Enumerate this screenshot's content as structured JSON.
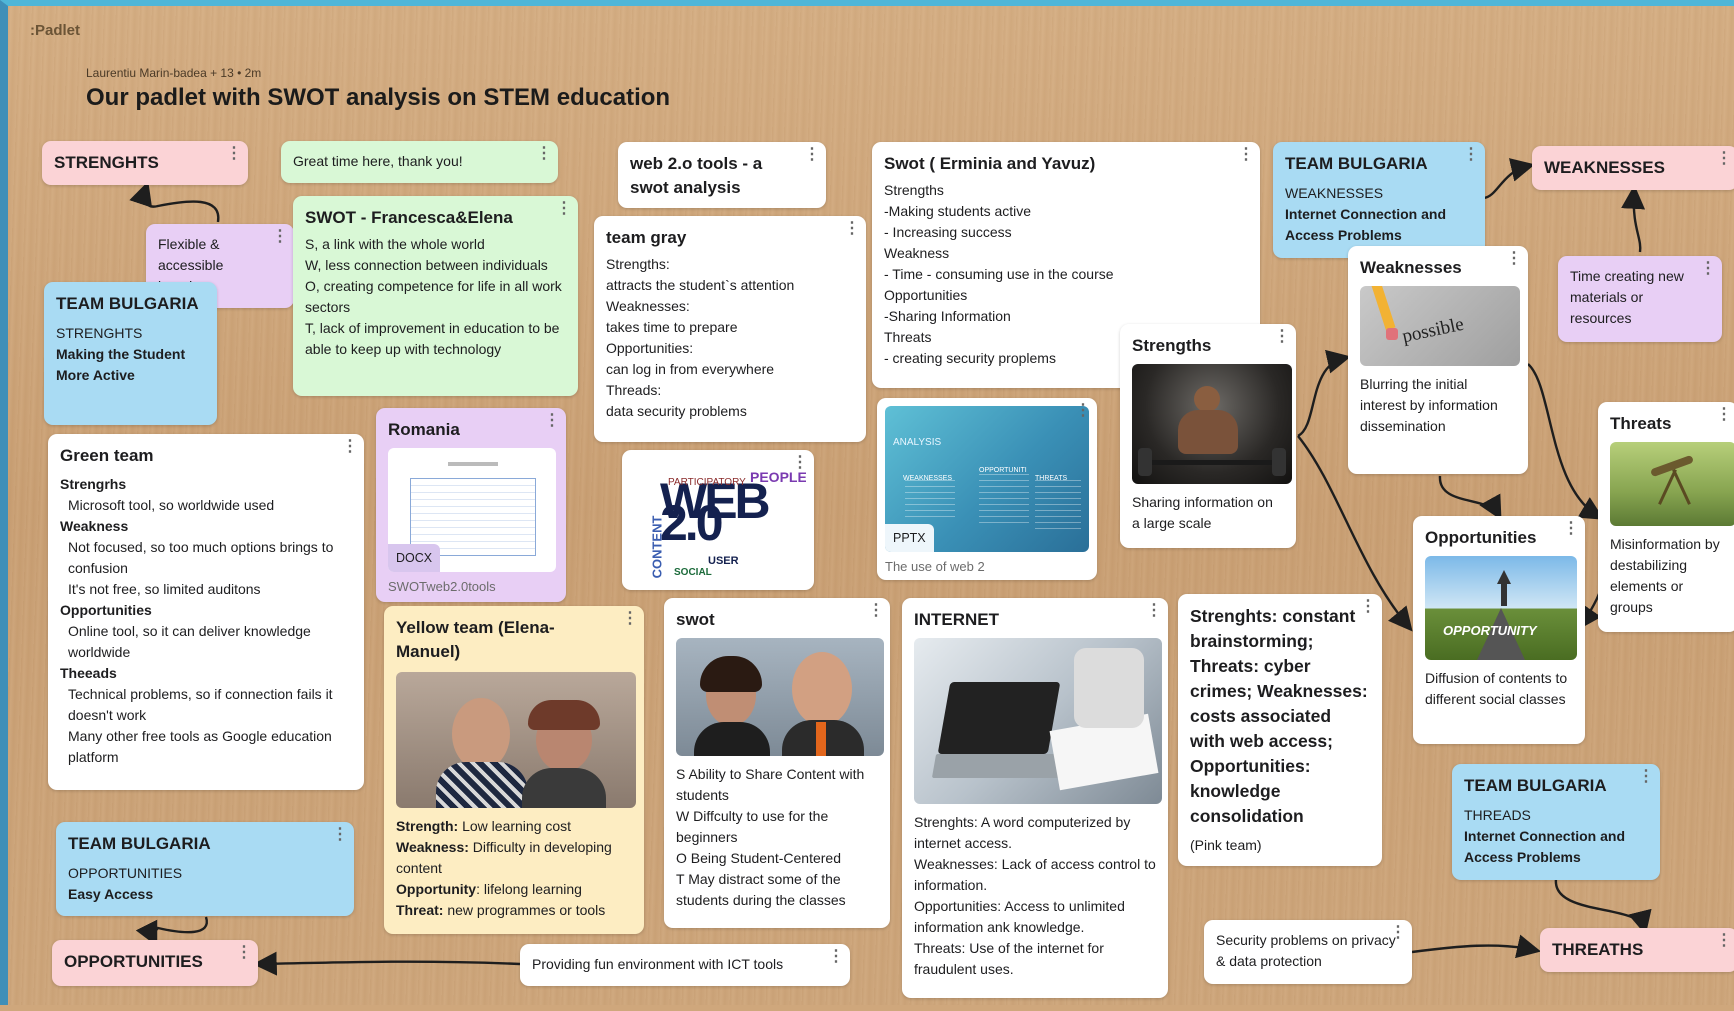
{
  "app": {
    "logo": ":Padlet"
  },
  "board": {
    "meta": "Laurentiu Marin-badea + 13 • 2m",
    "title": "Our padlet with SWOT analysis on STEM education"
  },
  "cards": {
    "strenghts": {
      "title": "STRENGHTS"
    },
    "great_time": {
      "text": "Great time here, thank you!"
    },
    "flexible": {
      "text": "Flexible & accessible learning"
    },
    "team_bg_strengths": {
      "title": "TEAM BULGARIA",
      "label": "STRENGHTS",
      "body": "Making the Student More Active"
    },
    "francesca": {
      "title": "SWOT - Francesca&Elena",
      "lines": [
        "S, a link with the whole world",
        "W, less connection between individuals",
        "O, creating competence for life in all work sectors",
        "T, lack of improvement in education to be able to keep up with technology"
      ]
    },
    "web20_title": {
      "title": "web 2.o tools - a swot analysis"
    },
    "team_gray": {
      "title": "team gray",
      "lines": [
        "Strengths:",
        "attracts the student`s attention",
        "Weaknesses:",
        "takes time to prepare",
        "Opportunities:",
        "can log in from everywhere",
        "Threads:",
        "data security problems"
      ]
    },
    "swot_erminia": {
      "title": "Swot ( Erminia and Yavuz)",
      "lines": [
        "Strengths",
        "-Making students active",
        "- Increasing success",
        "Weakness",
        "- Time - consuming use in the course",
        "Opportunities",
        "-Sharing Information",
        "Threats",
        "- creating security proplems"
      ]
    },
    "team_bg_weak": {
      "title": "TEAM BULGARIA",
      "label": "WEAKNESSES",
      "body": "Internet Connection and Access Problems"
    },
    "weaknesses_header": {
      "title": "WEAKNESSES"
    },
    "weaknesses_card": {
      "title": "Weaknesses",
      "image_word": "possible",
      "text": "Blurring the initial interest by information dissemination"
    },
    "time_creating": {
      "text": "Time creating new materials or resources"
    },
    "green_team": {
      "title": "Green team",
      "items": [
        {
          "head": "Strengrhs",
          "text": "Microsoft tool, so worldwide      used"
        },
        {
          "head": "Weakness",
          "text": "Not focused, so too much options brings to confusion"
        },
        {
          "head": "",
          "text": "It's not free, so limited auditons"
        },
        {
          "head": "Opportunities",
          "text": "Online tool, so it can deliver knowledge worldwide"
        },
        {
          "head": "Theeads",
          "text": "Technical problems, so if connection fails it doesn't work"
        },
        {
          "head": "",
          "text": "Many other free tools as Google education platform"
        }
      ]
    },
    "romania": {
      "title": "Romania",
      "badge": "DOCX",
      "caption": "SWOTweb2.0tools"
    },
    "web20_image": {
      "word": "WEB 2.0",
      "side1": "PARTICIPATORY",
      "side2": "PEOPLE",
      "side3": "CONTENT",
      "side4": "USER",
      "side5": "SOCIAL"
    },
    "pptx": {
      "badge": "PPTX",
      "caption": "The use of web 2",
      "slide_title": "ANALYSIS",
      "cols": [
        "WEAKNESSES",
        "OPPORTUNITI",
        "THREATS"
      ]
    },
    "strengths_card": {
      "title": "Strengths",
      "text": "Sharing information on a large scale"
    },
    "threats_card": {
      "title": "Threats",
      "text": "Misinformation by destabilizing elements or groups"
    },
    "opportunities_card": {
      "title": "Opportunities",
      "image_word": "OPPORTUNITY",
      "text": "Diffusion of contents to different social classes"
    },
    "yellow_team": {
      "title": "Yellow team (Elena-Manuel)",
      "rows": [
        {
          "k": "Strength:",
          "v": " Low learning cost"
        },
        {
          "k": "Weakness:",
          "v": " Difficulty in developing content"
        },
        {
          "k": "Opportunity",
          "v": ": lifelong learning"
        },
        {
          "k": "Threat:",
          "v": " new programmes or tools"
        }
      ]
    },
    "swot_small": {
      "title": "swot",
      "lines": [
        "S Ability to Share Content with students",
        "W Diffculty to use for the beginners",
        "O Being Student-Centered",
        "T May distract some of the students during the classes"
      ]
    },
    "internet": {
      "title": "INTERNET",
      "lines": [
        "Strenghts: A word computerized by internet access.",
        "Weaknesses: Lack of access control to information.",
        "Opportunities: Access to unlimited information ank knowledge.",
        "Threats: Use of the internet for fraudulent uses."
      ]
    },
    "pink_team": {
      "title": "Strenghts: constant brainstorming; Threats: cyber crimes; Weaknesses: costs associated with web access; Opportunities: knowledge consolidation",
      "text": "(Pink team)"
    },
    "team_bg_threads": {
      "title": "TEAM BULGARIA",
      "label": "THREADS",
      "body": "Internet Connection and Access Problems"
    },
    "team_bg_opp": {
      "title": "TEAM BULGARIA",
      "label": "OPPORTUNITIES",
      "body": "Easy Access"
    },
    "opportunities_header": {
      "title": "OPPORTUNITIES"
    },
    "providing_fun": {
      "text": "Providing fun environment with ICT tools"
    },
    "security": {
      "text": "Security problems on privacy & data protection"
    },
    "threaths_header": {
      "title": "THREATHS"
    }
  },
  "icons": {
    "menu": "⋮"
  },
  "colors": {
    "pink": "#fbd3d6",
    "green": "#d9f8d6",
    "blue": "#a9dbf3",
    "purple": "#e8cff5",
    "yellow": "#fdedc2",
    "connector": "#1e1e1e"
  }
}
